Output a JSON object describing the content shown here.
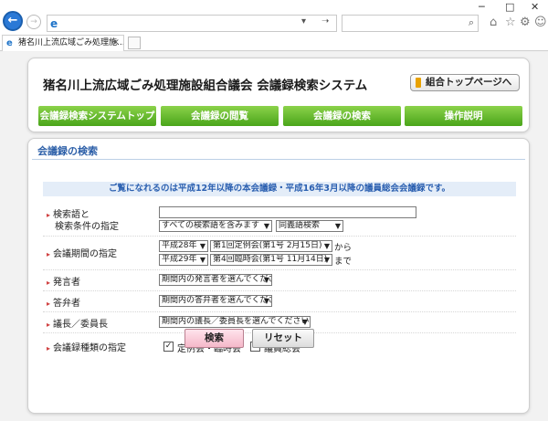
{
  "browser": {
    "window_controls": [
      "─",
      "□",
      "✕"
    ],
    "address_icon": "ie-icon",
    "address_value": "",
    "address_controls": [
      "▾",
      "➝"
    ],
    "search_icon": "search-icon",
    "toolbar_icons": [
      "home-icon",
      "star-icon",
      "gear-icon",
      "smiley-icon"
    ],
    "tab": {
      "title": "猪名川上流広域ごみ処理施...",
      "close": "×"
    }
  },
  "header": {
    "site_title": "猪名川上流広域ごみ処理施設組合議会 会議録検索システム",
    "top_link": "組合トップページへ",
    "nav": [
      {
        "label": "会議録検索システムトップ"
      },
      {
        "label": "会議録の閲覧"
      },
      {
        "label": "会議録の検索"
      },
      {
        "label": "操作説明"
      }
    ]
  },
  "search_panel": {
    "title": "会議録の検索",
    "notice": "ご覧になれるのは平成12年以降の本会議録・平成16年3月以降の議員総会会議録です。",
    "keyword": {
      "label_line1": "検索語と",
      "label_line2": "検索条件の指定",
      "value": "",
      "condition_select": "すべての検索語を含みます",
      "mode_select": "同義語検索"
    },
    "period": {
      "label": "会議期間の指定",
      "from_year": "平成28年",
      "from_session": "第1回定例会(第1号 2月15日)",
      "from_suffix": "から",
      "to_year": "平成29年",
      "to_session": "第4回臨時会(第1号 11月14日)",
      "to_suffix": "まで"
    },
    "speaker": {
      "label": "発言者",
      "select": "期間内の発言者を選んでください"
    },
    "respondent": {
      "label": "答弁者",
      "select": "期間内の答弁者を選んでください"
    },
    "chair": {
      "label": "議長／委員長",
      "select": "期間内の議長／委員長を選んでください"
    },
    "types": {
      "label": "会議録種類の指定",
      "option1": "定例会・臨時会",
      "option1_checked": true,
      "option2": "議員総会",
      "option2_checked": true
    },
    "search_button": "検索",
    "reset_button": "リセット"
  },
  "colors": {
    "nav_green": "#5cb82a",
    "title_blue": "#2c5fa8",
    "search_button_pink": "#f5c4d2"
  }
}
